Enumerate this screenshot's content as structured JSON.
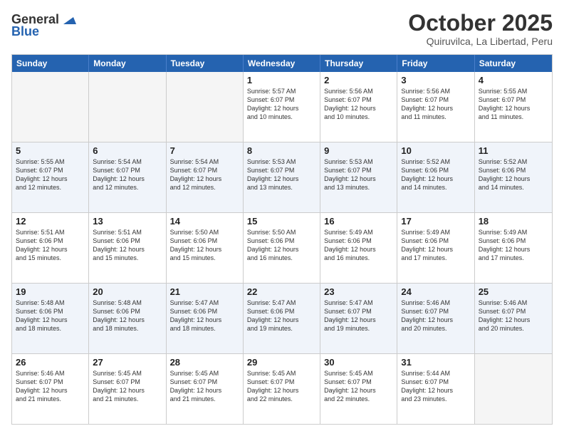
{
  "logo": {
    "general": "General",
    "blue": "Blue"
  },
  "title": "October 2025",
  "location": "Quiruvilca, La Libertad, Peru",
  "weekdays": [
    "Sunday",
    "Monday",
    "Tuesday",
    "Wednesday",
    "Thursday",
    "Friday",
    "Saturday"
  ],
  "rows": [
    [
      {
        "day": "",
        "lines": [],
        "empty": true
      },
      {
        "day": "",
        "lines": [],
        "empty": true
      },
      {
        "day": "",
        "lines": [],
        "empty": true
      },
      {
        "day": "1",
        "lines": [
          "Sunrise: 5:57 AM",
          "Sunset: 6:07 PM",
          "Daylight: 12 hours",
          "and 10 minutes."
        ],
        "empty": false
      },
      {
        "day": "2",
        "lines": [
          "Sunrise: 5:56 AM",
          "Sunset: 6:07 PM",
          "Daylight: 12 hours",
          "and 10 minutes."
        ],
        "empty": false
      },
      {
        "day": "3",
        "lines": [
          "Sunrise: 5:56 AM",
          "Sunset: 6:07 PM",
          "Daylight: 12 hours",
          "and 11 minutes."
        ],
        "empty": false
      },
      {
        "day": "4",
        "lines": [
          "Sunrise: 5:55 AM",
          "Sunset: 6:07 PM",
          "Daylight: 12 hours",
          "and 11 minutes."
        ],
        "empty": false
      }
    ],
    [
      {
        "day": "5",
        "lines": [
          "Sunrise: 5:55 AM",
          "Sunset: 6:07 PM",
          "Daylight: 12 hours",
          "and 12 minutes."
        ],
        "empty": false
      },
      {
        "day": "6",
        "lines": [
          "Sunrise: 5:54 AM",
          "Sunset: 6:07 PM",
          "Daylight: 12 hours",
          "and 12 minutes."
        ],
        "empty": false
      },
      {
        "day": "7",
        "lines": [
          "Sunrise: 5:54 AM",
          "Sunset: 6:07 PM",
          "Daylight: 12 hours",
          "and 12 minutes."
        ],
        "empty": false
      },
      {
        "day": "8",
        "lines": [
          "Sunrise: 5:53 AM",
          "Sunset: 6:07 PM",
          "Daylight: 12 hours",
          "and 13 minutes."
        ],
        "empty": false
      },
      {
        "day": "9",
        "lines": [
          "Sunrise: 5:53 AM",
          "Sunset: 6:07 PM",
          "Daylight: 12 hours",
          "and 13 minutes."
        ],
        "empty": false
      },
      {
        "day": "10",
        "lines": [
          "Sunrise: 5:52 AM",
          "Sunset: 6:06 PM",
          "Daylight: 12 hours",
          "and 14 minutes."
        ],
        "empty": false
      },
      {
        "day": "11",
        "lines": [
          "Sunrise: 5:52 AM",
          "Sunset: 6:06 PM",
          "Daylight: 12 hours",
          "and 14 minutes."
        ],
        "empty": false
      }
    ],
    [
      {
        "day": "12",
        "lines": [
          "Sunrise: 5:51 AM",
          "Sunset: 6:06 PM",
          "Daylight: 12 hours",
          "and 15 minutes."
        ],
        "empty": false
      },
      {
        "day": "13",
        "lines": [
          "Sunrise: 5:51 AM",
          "Sunset: 6:06 PM",
          "Daylight: 12 hours",
          "and 15 minutes."
        ],
        "empty": false
      },
      {
        "day": "14",
        "lines": [
          "Sunrise: 5:50 AM",
          "Sunset: 6:06 PM",
          "Daylight: 12 hours",
          "and 15 minutes."
        ],
        "empty": false
      },
      {
        "day": "15",
        "lines": [
          "Sunrise: 5:50 AM",
          "Sunset: 6:06 PM",
          "Daylight: 12 hours",
          "and 16 minutes."
        ],
        "empty": false
      },
      {
        "day": "16",
        "lines": [
          "Sunrise: 5:49 AM",
          "Sunset: 6:06 PM",
          "Daylight: 12 hours",
          "and 16 minutes."
        ],
        "empty": false
      },
      {
        "day": "17",
        "lines": [
          "Sunrise: 5:49 AM",
          "Sunset: 6:06 PM",
          "Daylight: 12 hours",
          "and 17 minutes."
        ],
        "empty": false
      },
      {
        "day": "18",
        "lines": [
          "Sunrise: 5:49 AM",
          "Sunset: 6:06 PM",
          "Daylight: 12 hours",
          "and 17 minutes."
        ],
        "empty": false
      }
    ],
    [
      {
        "day": "19",
        "lines": [
          "Sunrise: 5:48 AM",
          "Sunset: 6:06 PM",
          "Daylight: 12 hours",
          "and 18 minutes."
        ],
        "empty": false
      },
      {
        "day": "20",
        "lines": [
          "Sunrise: 5:48 AM",
          "Sunset: 6:06 PM",
          "Daylight: 12 hours",
          "and 18 minutes."
        ],
        "empty": false
      },
      {
        "day": "21",
        "lines": [
          "Sunrise: 5:47 AM",
          "Sunset: 6:06 PM",
          "Daylight: 12 hours",
          "and 18 minutes."
        ],
        "empty": false
      },
      {
        "day": "22",
        "lines": [
          "Sunrise: 5:47 AM",
          "Sunset: 6:06 PM",
          "Daylight: 12 hours",
          "and 19 minutes."
        ],
        "empty": false
      },
      {
        "day": "23",
        "lines": [
          "Sunrise: 5:47 AM",
          "Sunset: 6:07 PM",
          "Daylight: 12 hours",
          "and 19 minutes."
        ],
        "empty": false
      },
      {
        "day": "24",
        "lines": [
          "Sunrise: 5:46 AM",
          "Sunset: 6:07 PM",
          "Daylight: 12 hours",
          "and 20 minutes."
        ],
        "empty": false
      },
      {
        "day": "25",
        "lines": [
          "Sunrise: 5:46 AM",
          "Sunset: 6:07 PM",
          "Daylight: 12 hours",
          "and 20 minutes."
        ],
        "empty": false
      }
    ],
    [
      {
        "day": "26",
        "lines": [
          "Sunrise: 5:46 AM",
          "Sunset: 6:07 PM",
          "Daylight: 12 hours",
          "and 21 minutes."
        ],
        "empty": false
      },
      {
        "day": "27",
        "lines": [
          "Sunrise: 5:45 AM",
          "Sunset: 6:07 PM",
          "Daylight: 12 hours",
          "and 21 minutes."
        ],
        "empty": false
      },
      {
        "day": "28",
        "lines": [
          "Sunrise: 5:45 AM",
          "Sunset: 6:07 PM",
          "Daylight: 12 hours",
          "and 21 minutes."
        ],
        "empty": false
      },
      {
        "day": "29",
        "lines": [
          "Sunrise: 5:45 AM",
          "Sunset: 6:07 PM",
          "Daylight: 12 hours",
          "and 22 minutes."
        ],
        "empty": false
      },
      {
        "day": "30",
        "lines": [
          "Sunrise: 5:45 AM",
          "Sunset: 6:07 PM",
          "Daylight: 12 hours",
          "and 22 minutes."
        ],
        "empty": false
      },
      {
        "day": "31",
        "lines": [
          "Sunrise: 5:44 AM",
          "Sunset: 6:07 PM",
          "Daylight: 12 hours",
          "and 23 minutes."
        ],
        "empty": false
      },
      {
        "day": "",
        "lines": [],
        "empty": true
      }
    ]
  ]
}
